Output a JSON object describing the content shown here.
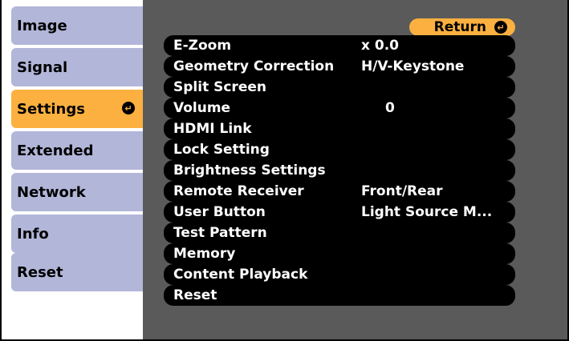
{
  "sidebar": {
    "items": [
      {
        "label": "Image",
        "selected": false
      },
      {
        "label": "Signal",
        "selected": false
      },
      {
        "label": "Settings",
        "selected": true
      },
      {
        "label": "Extended",
        "selected": false
      },
      {
        "label": "Network",
        "selected": false
      },
      {
        "label": "Info",
        "selected": false
      },
      {
        "label": "Reset",
        "selected": false
      }
    ]
  },
  "panel": {
    "return_label": "Return",
    "rows": [
      {
        "label": "E-Zoom",
        "value": "x  0.0"
      },
      {
        "label": "Geometry Correction",
        "value": "H/V-Keystone"
      },
      {
        "label": "Split Screen",
        "value": ""
      },
      {
        "label": "Volume",
        "value": "0"
      },
      {
        "label": "HDMI Link",
        "value": ""
      },
      {
        "label": "Lock Setting",
        "value": ""
      },
      {
        "label": "Brightness Settings",
        "value": ""
      },
      {
        "label": "Remote Receiver",
        "value": "Front/Rear"
      },
      {
        "label": "User Button",
        "value": "Light Source M..."
      },
      {
        "label": "Test Pattern",
        "value": ""
      },
      {
        "label": "Memory",
        "value": ""
      },
      {
        "label": "Content Playback",
        "value": ""
      },
      {
        "label": "Reset",
        "value": ""
      }
    ]
  },
  "colors": {
    "selected": "#fbb040",
    "sidebar_item": "#b2b6d9",
    "panel_bg": "#5a5a5a",
    "row_bg": "#000000"
  },
  "icons": {
    "enter": "enter-icon",
    "return": "return-icon"
  }
}
